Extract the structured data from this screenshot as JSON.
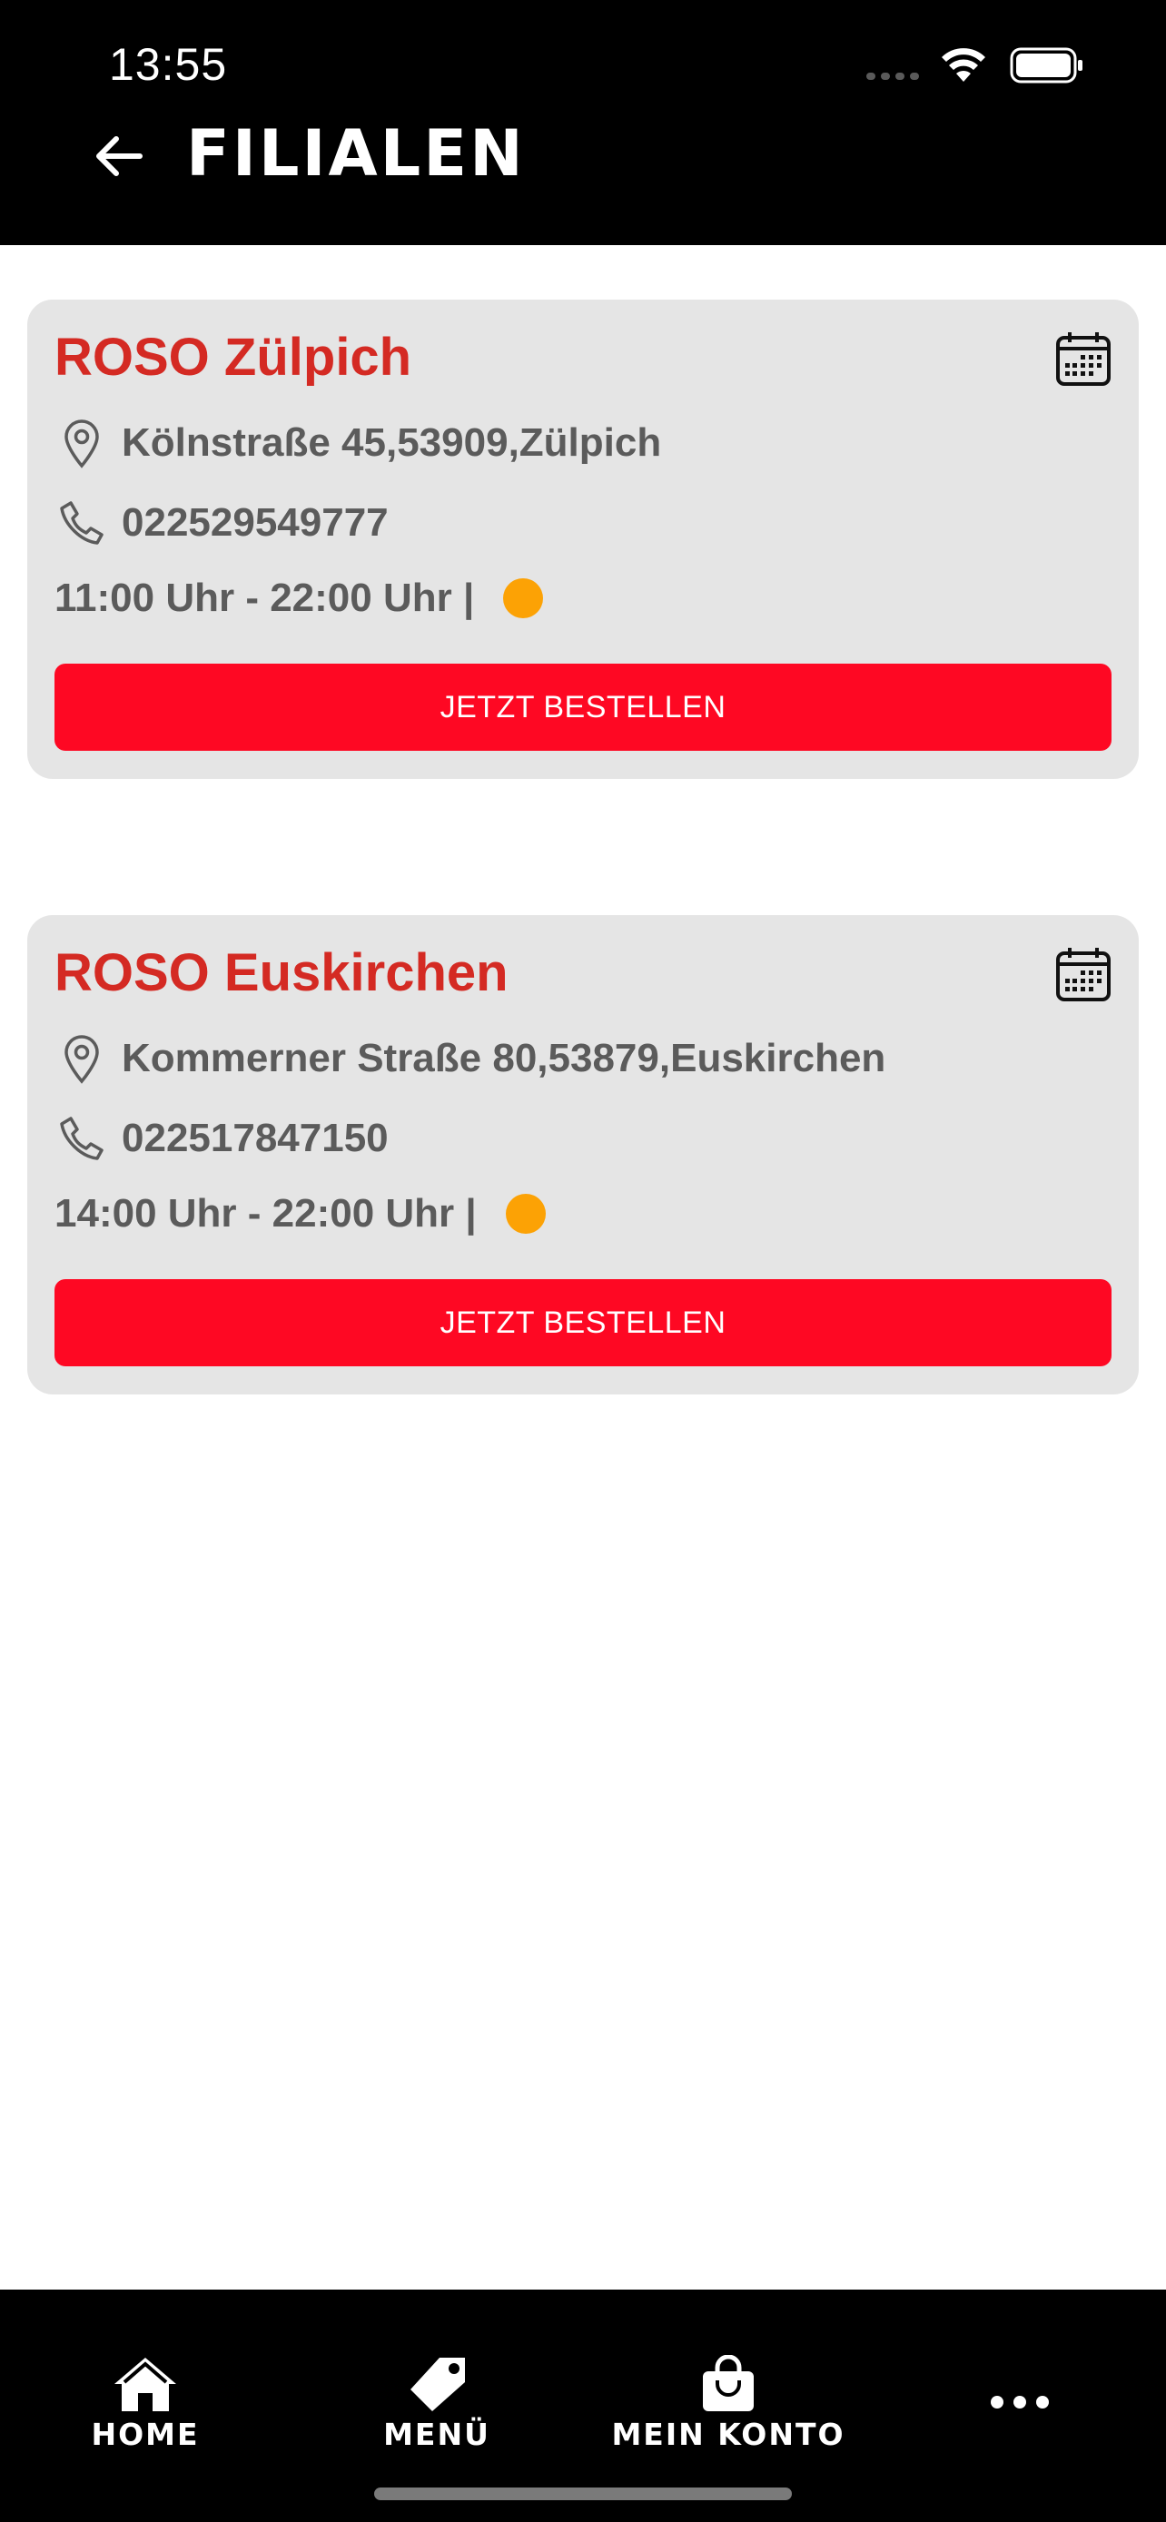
{
  "status_bar": {
    "time": "13:55"
  },
  "header": {
    "title": "FILIALEN"
  },
  "stores": [
    {
      "name": "ROSO Zülpich",
      "address": "Kölnstraße 45,53909,Zülpich",
      "phone": "022529549777",
      "hours": "11:00 Uhr - 22:00 Uhr |",
      "button": "JETZT BESTELLEN"
    },
    {
      "name": "ROSO Euskirchen",
      "address": "Kommerner Straße 80,53879,Euskirchen",
      "phone": "022517847150",
      "hours": "14:00 Uhr - 22:00 Uhr |",
      "button": "JETZT BESTELLEN"
    }
  ],
  "bottom_nav": {
    "home": "HOME",
    "menu": "MENÜ",
    "account": "MEIN KONTO"
  },
  "colors": {
    "accent_red": "#fe0823",
    "title_red": "#d42a23",
    "status_dot": "#fca205",
    "card_bg": "#e5e5e5"
  },
  "icons": [
    "back-arrow-icon",
    "calendar-icon",
    "location-pin-icon",
    "phone-icon",
    "home-icon",
    "tag-icon",
    "shopping-bag-icon",
    "more-icon",
    "wifi-icon",
    "battery-icon"
  ]
}
